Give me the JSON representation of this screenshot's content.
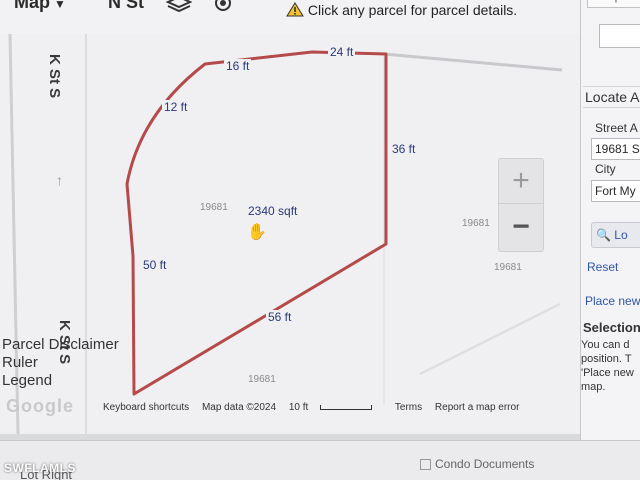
{
  "toolbar": {
    "map_menu_label": "Map",
    "street_tab_label": "N St",
    "notice_text": "Click any parcel for parcel details."
  },
  "map": {
    "street_labels": [
      "K St S",
      "K St S"
    ],
    "dimensions": [
      "24 ft",
      "16 ft",
      "12 ft",
      "36 ft",
      "50 ft",
      "56 ft"
    ],
    "parcel_numbers": [
      "19681",
      "19681",
      "19681",
      "19681"
    ],
    "area_label": "2340 sqft",
    "zoom_in": "+",
    "zoom_out": "−",
    "legend": [
      "Parcel Disclaimer",
      "Ruler",
      "Legend"
    ],
    "google_logo": "Google",
    "footer": {
      "shortcuts": "Keyboard shortcuts",
      "map_data": "Map data ©2024",
      "scale": "10 ft",
      "terms": "Terms",
      "report": "Report a map error"
    },
    "parcel_color": "#b54a4a"
  },
  "panel": {
    "top_button": "Jump t",
    "locate_title": "Locate A",
    "street_label": "Street A",
    "street_value": "19681 S",
    "city_label": "City",
    "city_value": "Fort My",
    "locate_button": "Lo",
    "reset": "Reset",
    "place_new": "Place new",
    "selection_title": "Selection",
    "selection_lines": [
      "You can d",
      "position. T",
      "'Place new",
      "map."
    ]
  },
  "bottom": {
    "condo_docs": "Condo Documents",
    "left_text": "Lot Right",
    "watermark": "SWFLAMLS"
  }
}
